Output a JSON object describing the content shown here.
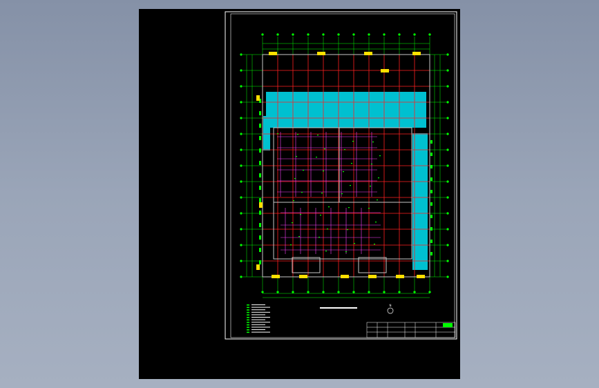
{
  "drawing": {
    "title_label": "",
    "north_marker": "①",
    "north_label": "N",
    "legend_items": [
      "",
      "",
      "",
      "",
      "",
      "",
      "",
      "",
      "",
      "",
      "",
      ""
    ],
    "title_block_cells": [
      "",
      "",
      "",
      "",
      "",
      ""
    ]
  },
  "colors": {
    "background": "#000000",
    "frame": "#ffffff",
    "grid_red": "#ff2020",
    "axis_green": "#00ff00",
    "cyan_zone": "#00c8d8",
    "pipe_magenta": "#ff40ff",
    "yellow_mark": "#ffe000",
    "wall_gray": "#c0c0c0"
  }
}
